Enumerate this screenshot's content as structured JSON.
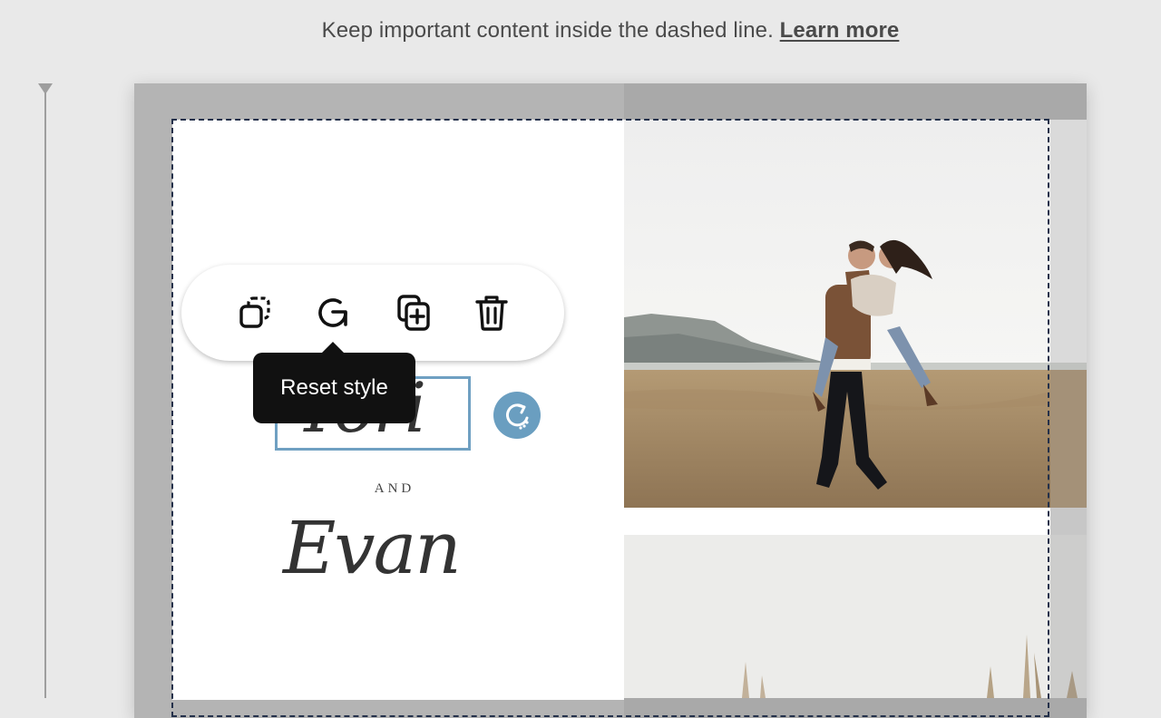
{
  "hint": {
    "text": "Keep important content inside the dashed line. ",
    "link": "Learn more"
  },
  "card": {
    "name_top": "Tori",
    "and": "AND",
    "name_bottom": "Evan"
  },
  "toolbar": {
    "items": [
      {
        "icon": "bring-front-icon",
        "label": "Arrange"
      },
      {
        "icon": "reset-icon",
        "label": "Reset style"
      },
      {
        "icon": "duplicate-icon",
        "label": "Duplicate"
      },
      {
        "icon": "trash-icon",
        "label": "Delete"
      }
    ],
    "tooltip": "Reset style"
  },
  "colors": {
    "accent": "#6a9ec0",
    "tooltip_bg": "#111111",
    "bleed": "#b4b4b4",
    "safe_line": "#23304a"
  }
}
